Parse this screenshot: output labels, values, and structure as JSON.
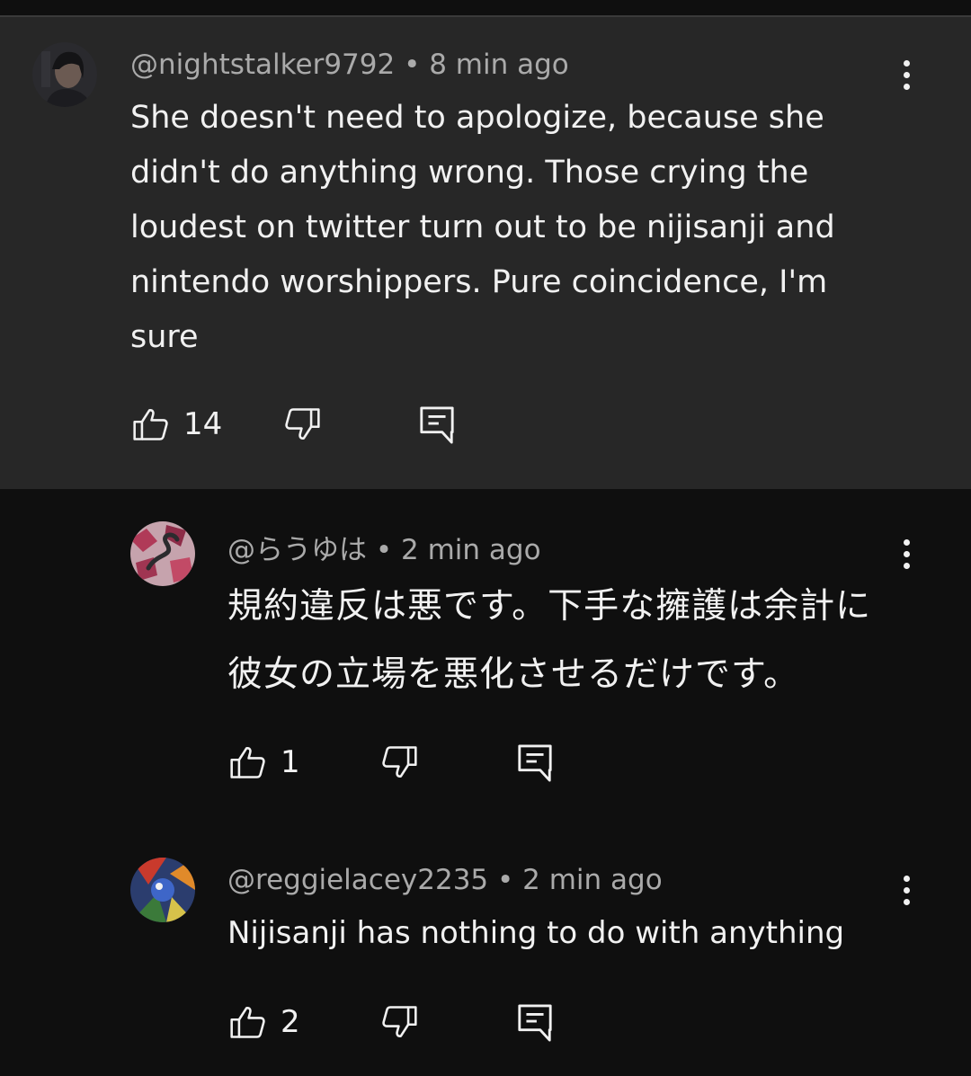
{
  "comments": [
    {
      "author": "@nightstalker9792",
      "time": "8 min ago",
      "text": "She doesn't need to apologize, because she didn't do anything wrong. Those crying the loudest on twitter turn out to be nijisanji and nintendo worshippers. Pure coincidence, I'm sure",
      "likes": "14"
    },
    {
      "author": "@らうゆは",
      "time": "2 min ago",
      "text": "規約違反は悪です。下手な擁護は余計に彼女の立場を悪化させるだけです。",
      "likes": "1"
    },
    {
      "author": "@reggielacey2235",
      "time": "2 min ago",
      "text": "Nijisanji has nothing to do with anything",
      "likes": "2"
    }
  ],
  "separator": " • ",
  "colors": {
    "background": "#0f0f0f",
    "highlight": "#272727",
    "meta_text": "#aaaaaa",
    "text": "#f1f1f1"
  },
  "icons": {
    "like": "thumbs-up-icon",
    "dislike": "thumbs-down-icon",
    "reply": "reply-icon",
    "more": "more-vert-icon"
  }
}
